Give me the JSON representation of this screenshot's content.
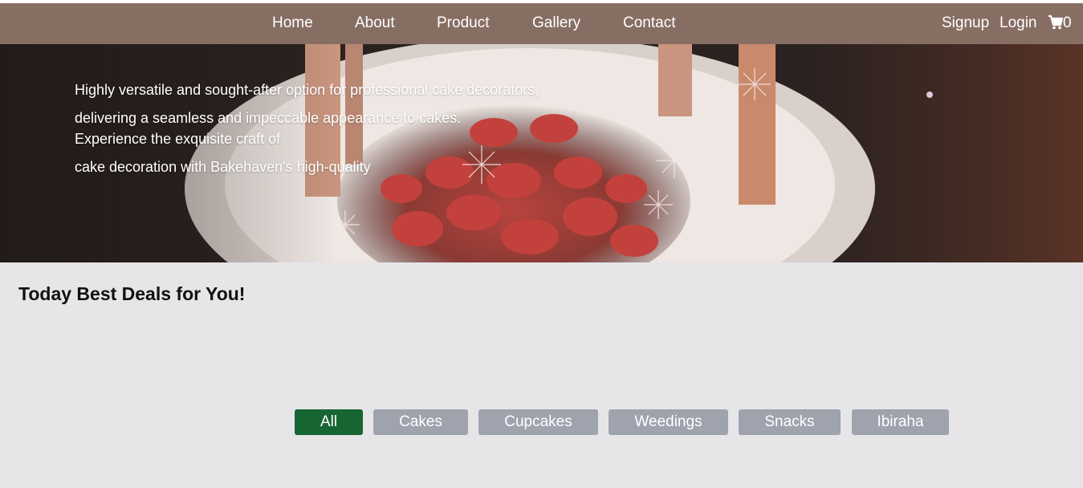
{
  "nav": {
    "links": [
      "Home",
      "About",
      "Product",
      "Gallery",
      "Contact"
    ],
    "signup": "Signup",
    "login": "Login",
    "cart_icon": "shopping-cart-icon",
    "cart_count": "0"
  },
  "hero": {
    "lines": [
      "Highly versatile and sought-after option for professional cake decorators,",
      "delivering a seamless and impeccable appearance to cakes.",
      "Experience the exquisite craft of",
      "cake decoration with Bakehaven's high-quality"
    ]
  },
  "deals": {
    "title": "Today Best Deals for You!"
  },
  "filters": {
    "items": [
      "All",
      "Cakes",
      "Cupcakes",
      "Weedings",
      "Snacks",
      "Ibiraha"
    ],
    "active": "All"
  },
  "colors": {
    "nav_bg": "#876e63",
    "active_filter": "#176533",
    "inactive_filter": "#9fa3ae",
    "page_bg": "#e6e6e9"
  }
}
